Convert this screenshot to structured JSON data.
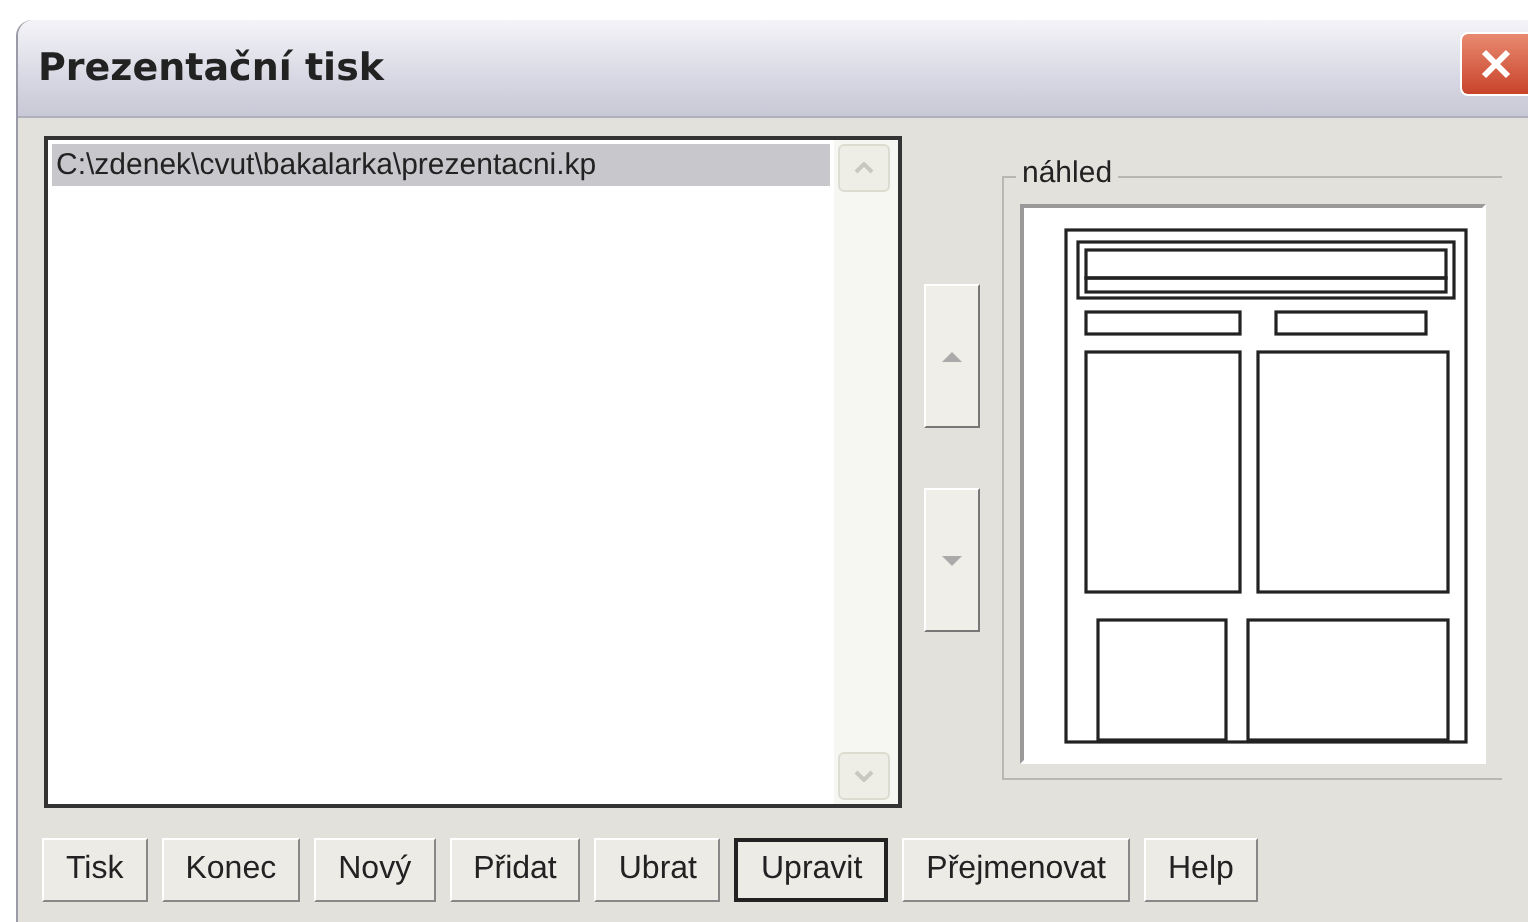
{
  "window": {
    "title": "Prezentační tisk"
  },
  "file_list": {
    "items": [
      {
        "label": "C:\\zdenek\\cvut\\bakalarka\\prezentacni.kp",
        "selected": true
      }
    ]
  },
  "preview": {
    "label": "náhled"
  },
  "buttons": [
    {
      "label": "Tisk",
      "default": false
    },
    {
      "label": "Konec",
      "default": false
    },
    {
      "label": "Nový",
      "default": false
    },
    {
      "label": "Přidat",
      "default": false
    },
    {
      "label": "Ubrat",
      "default": false
    },
    {
      "label": "Upravit",
      "default": true
    },
    {
      "label": "Přejmenovat",
      "default": false
    },
    {
      "label": "Help",
      "default": false
    }
  ]
}
